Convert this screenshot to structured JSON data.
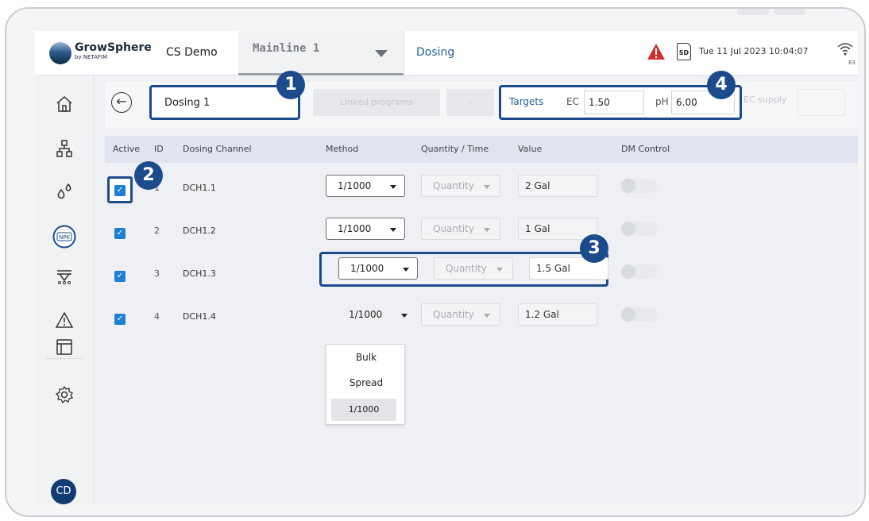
{
  "topbar": {
    "logo_name": "GrowSphere",
    "logo_sub": "by NETAFIM",
    "site": "CS Demo",
    "line": "Mainline 1",
    "page": "Dosing",
    "datetime": "Tue 11 Jul 2023  10:04:07",
    "wifi_strength": "83",
    "sd_label": "SD",
    "alert_color": "#d42e2e"
  },
  "sidebar": {
    "items": [
      "home-icon",
      "network-icon",
      "water-drops-icon",
      "npk-icon",
      "irrigation-icon",
      "alert-icon",
      "table-icon",
      "settings-icon"
    ],
    "active_item": "npk-icon",
    "npk_label": "NPK",
    "avatar": "CD"
  },
  "header": {
    "program_name": "Dosing 1",
    "linked_programs": "Linked programs",
    "linked_value": "-",
    "targets_label": "Targets",
    "ec_label": "EC",
    "ec_value": "1.50",
    "ph_label": "pH",
    "ph_value": "6.00",
    "ec_supply": "EC supply"
  },
  "columns": {
    "active": "Active",
    "id": "ID",
    "channel": "Dosing Channel",
    "method": "Method",
    "qty": "Quantity / Time",
    "value": "Value",
    "dm": "DM Control"
  },
  "rows": [
    {
      "id": "1",
      "channel": "DCH1.1",
      "method": "1/1000",
      "qty": "Quantity",
      "value": "2 Gal"
    },
    {
      "id": "2",
      "channel": "DCH1.2",
      "method": "1/1000",
      "qty": "Quantity",
      "value": "1 Gal"
    },
    {
      "id": "3",
      "channel": "DCH1.3",
      "method": "1/1000",
      "qty": "Quantity",
      "value": "1.5 Gal"
    },
    {
      "id": "4",
      "channel": "DCH1.4",
      "method": "1/1000",
      "qty": "Quantity",
      "value": "1.2 Gal"
    }
  ],
  "method_options": [
    "Bulk",
    "Spread",
    "1/1000"
  ],
  "badges": [
    "1",
    "2",
    "3",
    "4"
  ],
  "accent_color": "#1c4b8c"
}
